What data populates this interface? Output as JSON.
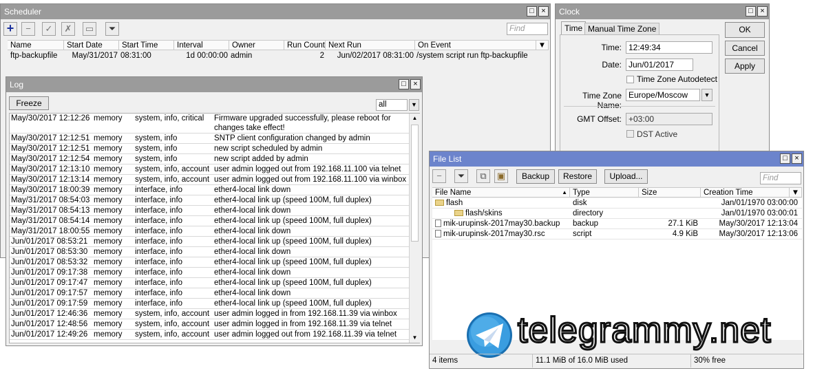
{
  "scheduler": {
    "title": "Scheduler",
    "find_placeholder": "Find",
    "columns": [
      "Name",
      "Start Date",
      "Start Time",
      "Interval",
      "Owner",
      "Run Count",
      "Next Run",
      "On Event"
    ],
    "rows": [
      [
        "ftp-backupfile",
        "May/31/2017",
        "08:31:00",
        "1d 00:00:00",
        "admin",
        "2",
        "Jun/02/2017 08:31:00",
        "/system script run ftp-backupfile"
      ]
    ]
  },
  "clock": {
    "title": "Clock",
    "tabs": [
      "Time",
      "Manual Time Zone"
    ],
    "time_label": "Time:",
    "time_value": "12:49:34",
    "date_label": "Date:",
    "date_value": "Jun/01/2017",
    "autodetect_label": "Time Zone Autodetect",
    "tz_label": "Time Zone Name:",
    "tz_value": "Europe/Moscow",
    "gmt_label": "GMT Offset:",
    "gmt_value": "+03:00",
    "dst_label": "DST Active",
    "ok": "OK",
    "cancel": "Cancel",
    "apply": "Apply"
  },
  "log": {
    "title": "Log",
    "freeze": "Freeze",
    "filter_value": "all",
    "rows": [
      [
        "May/30/2017 12:12:26",
        "memory",
        "system, info, critical",
        "Firmware upgraded successfully, please reboot for changes take effect!"
      ],
      [
        "May/30/2017 12:12:51",
        "memory",
        "system, info",
        "SNTP client configuration changed by admin"
      ],
      [
        "May/30/2017 12:12:51",
        "memory",
        "system, info",
        "new script scheduled by admin"
      ],
      [
        "May/30/2017 12:12:54",
        "memory",
        "system, info",
        "new script added by admin"
      ],
      [
        "May/30/2017 12:13:10",
        "memory",
        "system, info, account",
        "user admin logged out from 192.168.11.100 via telnet"
      ],
      [
        "May/30/2017 12:13:14",
        "memory",
        "system, info, account",
        "user admin logged out from 192.168.11.100 via winbox"
      ],
      [
        "May/30/2017 18:00:39",
        "memory",
        "interface, info",
        "ether4-local link down"
      ],
      [
        "May/31/2017 08:54:03",
        "memory",
        "interface, info",
        "ether4-local link up (speed 100M, full duplex)"
      ],
      [
        "May/31/2017 08:54:13",
        "memory",
        "interface, info",
        "ether4-local link down"
      ],
      [
        "May/31/2017 08:54:14",
        "memory",
        "interface, info",
        "ether4-local link up (speed 100M, full duplex)"
      ],
      [
        "May/31/2017 18:00:55",
        "memory",
        "interface, info",
        "ether4-local link down"
      ],
      [
        "Jun/01/2017 08:53:21",
        "memory",
        "interface, info",
        "ether4-local link up (speed 100M, full duplex)"
      ],
      [
        "Jun/01/2017 08:53:30",
        "memory",
        "interface, info",
        "ether4-local link down"
      ],
      [
        "Jun/01/2017 08:53:32",
        "memory",
        "interface, info",
        "ether4-local link up (speed 100M, full duplex)"
      ],
      [
        "Jun/01/2017 09:17:38",
        "memory",
        "interface, info",
        "ether4-local link down"
      ],
      [
        "Jun/01/2017 09:17:47",
        "memory",
        "interface, info",
        "ether4-local link up (speed 100M, full duplex)"
      ],
      [
        "Jun/01/2017 09:17:57",
        "memory",
        "interface, info",
        "ether4-local link down"
      ],
      [
        "Jun/01/2017 09:17:59",
        "memory",
        "interface, info",
        "ether4-local link up (speed 100M, full duplex)"
      ],
      [
        "Jun/01/2017 12:46:36",
        "memory",
        "system, info, account",
        "user admin logged in from 192.168.11.39 via winbox"
      ],
      [
        "Jun/01/2017 12:48:56",
        "memory",
        "system, info, account",
        "user admin logged in from 192.168.11.39 via telnet"
      ],
      [
        "Jun/01/2017 12:49:26",
        "memory",
        "system, info, account",
        "user admin logged out from 192.168.11.39 via telnet"
      ]
    ]
  },
  "filelist": {
    "title": "File List",
    "backup": "Backup",
    "restore": "Restore",
    "upload": "Upload...",
    "find_placeholder": "Find",
    "columns": [
      "File Name",
      "Type",
      "Size",
      "Creation Time"
    ],
    "rows": [
      {
        "icon": "folder-icon",
        "indent": 0,
        "name": "flash",
        "type": "disk",
        "size": "",
        "time": "Jan/01/1970 03:00:00"
      },
      {
        "icon": "folder-icon",
        "indent": 1,
        "name": "flash/skins",
        "type": "directory",
        "size": "",
        "time": "Jan/01/1970 03:00:01"
      },
      {
        "icon": "file-icon",
        "indent": 0,
        "name": "mik-urupinsk-2017may30.backup",
        "type": "backup",
        "size": "27.1 KiB",
        "time": "May/30/2017 12:13:04"
      },
      {
        "icon": "file-icon",
        "indent": 0,
        "name": "mik-urupinsk-2017may30.rsc",
        "type": "script",
        "size": "4.9 KiB",
        "time": "May/30/2017 12:13:06"
      }
    ],
    "status_items": "4 items",
    "status_used": "11.1 MiB of 16.0 MiB used",
    "status_free": "30% free"
  },
  "watermark": {
    "text": "telegrammy.net",
    "icon": "telegram-logo-icon"
  },
  "colors": {
    "active_title": "#6c84cc",
    "inactive_title": "#9b9b9b",
    "add_icon": "#1a2f9c"
  }
}
